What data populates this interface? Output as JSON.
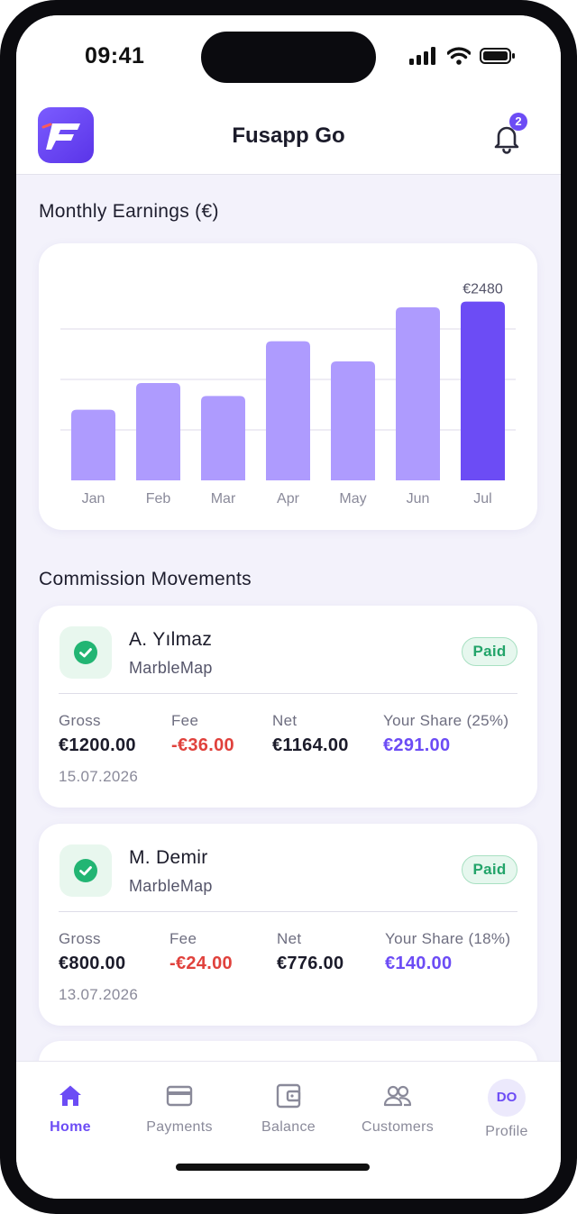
{
  "status_bar": {
    "time": "09:41"
  },
  "header": {
    "title": "Fusapp Go",
    "notification_count": "2"
  },
  "earnings": {
    "section_title": "Monthly Earnings (€)",
    "peak_label": "€2480"
  },
  "chart_data": {
    "type": "bar",
    "title": "Monthly Earnings (€)",
    "categories": [
      "Jan",
      "Feb",
      "Mar",
      "Apr",
      "May",
      "Jun",
      "Jul"
    ],
    "values": [
      980,
      1350,
      1170,
      1930,
      1650,
      2400,
      2480
    ],
    "ylim": [
      0,
      2600
    ],
    "highlight_index": 6,
    "data_labels": {
      "6": "€2480"
    },
    "grid": true,
    "colors": {
      "bar": "#ae9bfe",
      "highlight": "#6c4cf5",
      "grid": "#e3e1ee"
    }
  },
  "commissions": {
    "section_title": "Commission Movements",
    "items": [
      {
        "name": "A. Yılmaz",
        "company": "MarbleMap",
        "status": "Paid",
        "gross_label": "Gross",
        "gross": "€1200.00",
        "fee_label": "Fee",
        "fee": "-€36.00",
        "net_label": "Net",
        "net": "€1164.00",
        "share_label": "Your Share (25%)",
        "share": "€291.00",
        "date": "15.07.2026"
      },
      {
        "name": "M. Demir",
        "company": "MarbleMap",
        "status": "Paid",
        "gross_label": "Gross",
        "gross": "€800.00",
        "fee_label": "Fee",
        "fee": "-€24.00",
        "net_label": "Net",
        "net": "€776.00",
        "share_label": "Your Share (18%)",
        "share": "€140.00",
        "date": "13.07.2026"
      }
    ]
  },
  "tabbar": {
    "home": "Home",
    "payments": "Payments",
    "balance": "Balance",
    "customers": "Customers",
    "profile": "Profile",
    "profile_initials": "DO"
  },
  "colors": {
    "accent": "#6c4cf5",
    "success": "#22b573",
    "danger": "#e0413c"
  }
}
